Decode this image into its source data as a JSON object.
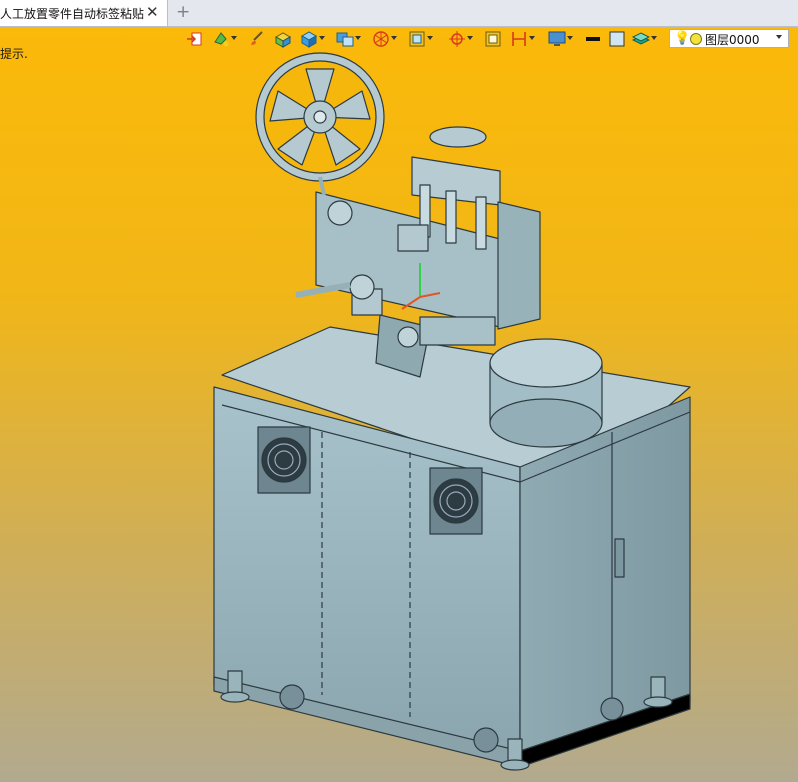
{
  "document": {
    "tab_title": "人工放置零件自动标签粘贴",
    "close_glyph": "✕",
    "new_tab_glyph": "+"
  },
  "viewport": {
    "hint_text": "提示.",
    "background": {
      "top": "#fbb909",
      "bottom": "#b2aa8f"
    }
  },
  "toolbar": {
    "layer_select": {
      "value": "图层0000"
    },
    "colors": {
      "line_color": "#111111",
      "fill_color": "#cfe6f2",
      "accent": "#e25522"
    }
  },
  "model": {
    "body_color": "#9fbac3",
    "edge_color": "#2c3a40"
  }
}
